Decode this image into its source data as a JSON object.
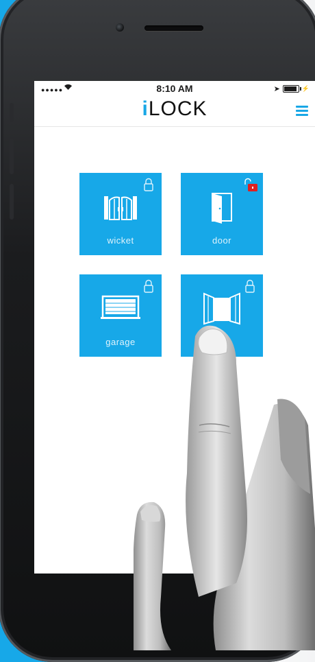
{
  "status_bar": {
    "signal": "●●●●●",
    "time": "8:10 AM",
    "battery_level": 0.9
  },
  "header": {
    "logo_prefix": "i",
    "logo_rest": "LOCK",
    "menu_icon": "hamburger-menu-icon"
  },
  "tiles": [
    {
      "label": "wicket",
      "icon": "wicket-gate-icon",
      "lock": "locked"
    },
    {
      "label": "door",
      "icon": "door-open-icon",
      "lock": "unlocked"
    },
    {
      "label": "garage",
      "icon": "garage-door-icon",
      "lock": "locked"
    },
    {
      "label": "gate",
      "icon": "gate-open-icon",
      "lock": "locked"
    }
  ],
  "colors": {
    "accent": "#17a8e8",
    "unlock_badge": "#e02020",
    "background": "#ffffff"
  }
}
